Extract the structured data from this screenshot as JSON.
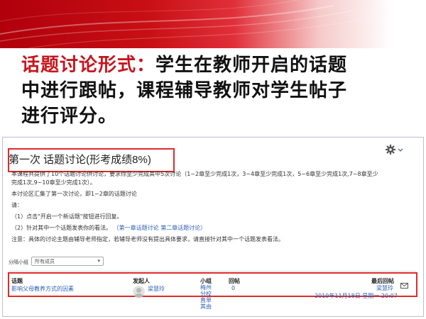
{
  "heading": {
    "accent": "话题讨论形式：",
    "line1_rest": "学生在教师开启的话题",
    "line2": "中进行跟帖，课程辅导教师对学生帖子",
    "line3": "进行评分。"
  },
  "forum": {
    "title": "第一次 话题讨论(形考成绩8%)",
    "desc": [
      "本课程共提供了10个话题讨论供讨论，要求你至少完成其中5次讨论（1~2章至少完成1次，3~4章至少完成1次，5~6章至少完成1次,7~8章至少",
      "完成1次,9~10章至少完成1次）。",
      "本讨论区汇集了第一次讨论，即1~2章的话题讨论",
      "请：",
      "（1）点击\"开启一个新话题\"按钮进行回复。",
      "（2）针对其中一个话题发表你的看法。",
      "注意：具体的讨论主题由辅导老师指定，若辅导老师没有提出具体要求，请直接针对其中一个话题发表看法。"
    ],
    "link1": "（第一章话题讨论",
    "link2": "第二章话题讨论）",
    "group_label": "分隔小组",
    "group_value": "所有成员",
    "columns": {
      "topic": "话题",
      "starter": "发起人",
      "group": "小组",
      "replies": "回帖",
      "last_post": "最后回帖"
    },
    "row": {
      "topic": "影响父母教养方式的因素",
      "starter": "梁慧玲",
      "group_lines": [
        "梅州",
        "分校",
        "直单",
        "其由"
      ],
      "replies": "0",
      "last_user": "梁慧玲",
      "last_date": "2019年11月18日 星期一 20:07"
    }
  },
  "colors": {
    "accent": "#c8141c",
    "link": "#2b5fb4",
    "highlight_box": "#e02a2a"
  },
  "icons": [
    "gear-icon",
    "chevron-down-icon",
    "avatar-icon",
    "envelope-icon"
  ]
}
